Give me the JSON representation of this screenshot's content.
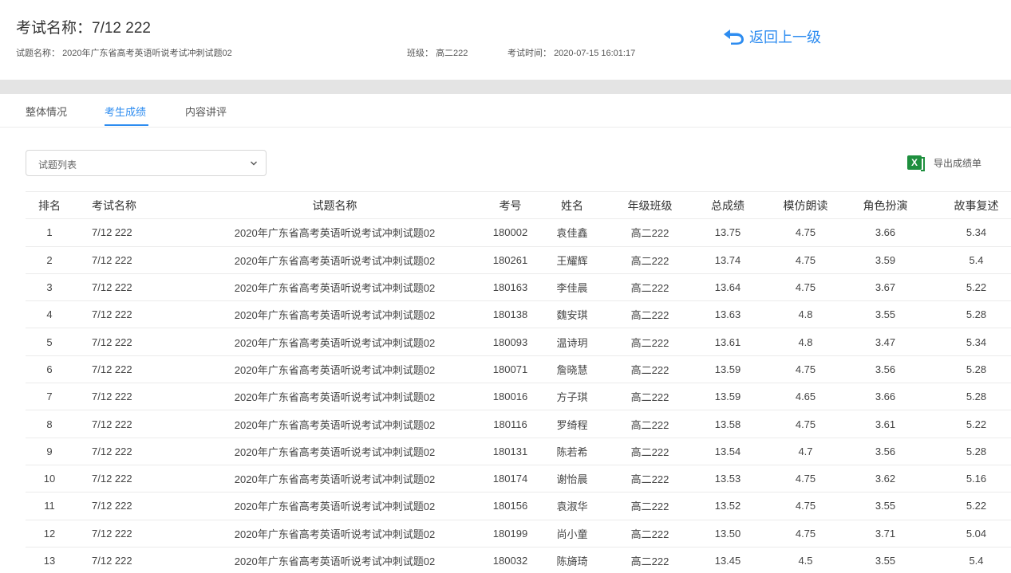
{
  "header": {
    "exam_title": "考试名称：7/12 222",
    "paper_label": "试题名称：",
    "paper_name": "2020年广东省高考英语听说考试冲刺试题02",
    "class_label": "班级：",
    "class_name": "高二222",
    "time_label": "考试时间：",
    "time_value": "2020-07-15 16:01:17",
    "back_label": "返回上一级"
  },
  "tabs": [
    {
      "label": "整体情况",
      "active": false
    },
    {
      "label": "考生成绩",
      "active": true
    },
    {
      "label": "内容讲评",
      "active": false
    }
  ],
  "toolbar": {
    "select_value": "试题列表",
    "export_label": "导出成绩单",
    "export_icon": "excel-icon"
  },
  "colors": {
    "accent": "#2d8cf0",
    "excel": "#1e8f3e"
  },
  "table": {
    "columns": [
      "排名",
      "考试名称",
      "试题名称",
      "考号",
      "姓名",
      "年级班级",
      "总成绩",
      "模仿朗读",
      "角色扮演",
      "故事复述"
    ],
    "rows": [
      [
        "1",
        "7/12 222",
        "2020年广东省高考英语听说考试冲刺试题02",
        "180002",
        "袁佳鑫",
        "高二222",
        "13.75",
        "4.75",
        "3.66",
        "5.34"
      ],
      [
        "2",
        "7/12 222",
        "2020年广东省高考英语听说考试冲刺试题02",
        "180261",
        "王耀辉",
        "高二222",
        "13.74",
        "4.75",
        "3.59",
        "5.4"
      ],
      [
        "3",
        "7/12 222",
        "2020年广东省高考英语听说考试冲刺试题02",
        "180163",
        "李佳晨",
        "高二222",
        "13.64",
        "4.75",
        "3.67",
        "5.22"
      ],
      [
        "4",
        "7/12 222",
        "2020年广东省高考英语听说考试冲刺试题02",
        "180138",
        "魏安琪",
        "高二222",
        "13.63",
        "4.8",
        "3.55",
        "5.28"
      ],
      [
        "5",
        "7/12 222",
        "2020年广东省高考英语听说考试冲刺试题02",
        "180093",
        "温诗玥",
        "高二222",
        "13.61",
        "4.8",
        "3.47",
        "5.34"
      ],
      [
        "6",
        "7/12 222",
        "2020年广东省高考英语听说考试冲刺试题02",
        "180071",
        "詹晓慧",
        "高二222",
        "13.59",
        "4.75",
        "3.56",
        "5.28"
      ],
      [
        "7",
        "7/12 222",
        "2020年广东省高考英语听说考试冲刺试题02",
        "180016",
        "方子琪",
        "高二222",
        "13.59",
        "4.65",
        "3.66",
        "5.28"
      ],
      [
        "8",
        "7/12 222",
        "2020年广东省高考英语听说考试冲刺试题02",
        "180116",
        "罗绮程",
        "高二222",
        "13.58",
        "4.75",
        "3.61",
        "5.22"
      ],
      [
        "9",
        "7/12 222",
        "2020年广东省高考英语听说考试冲刺试题02",
        "180131",
        "陈若希",
        "高二222",
        "13.54",
        "4.7",
        "3.56",
        "5.28"
      ],
      [
        "10",
        "7/12 222",
        "2020年广东省高考英语听说考试冲刺试题02",
        "180174",
        "谢怡晨",
        "高二222",
        "13.53",
        "4.75",
        "3.62",
        "5.16"
      ],
      [
        "11",
        "7/12 222",
        "2020年广东省高考英语听说考试冲刺试题02",
        "180156",
        "袁淑华",
        "高二222",
        "13.52",
        "4.75",
        "3.55",
        "5.22"
      ],
      [
        "12",
        "7/12 222",
        "2020年广东省高考英语听说考试冲刺试题02",
        "180199",
        "尚小童",
        "高二222",
        "13.50",
        "4.75",
        "3.71",
        "5.04"
      ],
      [
        "13",
        "7/12 222",
        "2020年广东省高考英语听说考试冲刺试题02",
        "180032",
        "陈旖琦",
        "高二222",
        "13.45",
        "4.5",
        "3.55",
        "5.4"
      ]
    ]
  }
}
